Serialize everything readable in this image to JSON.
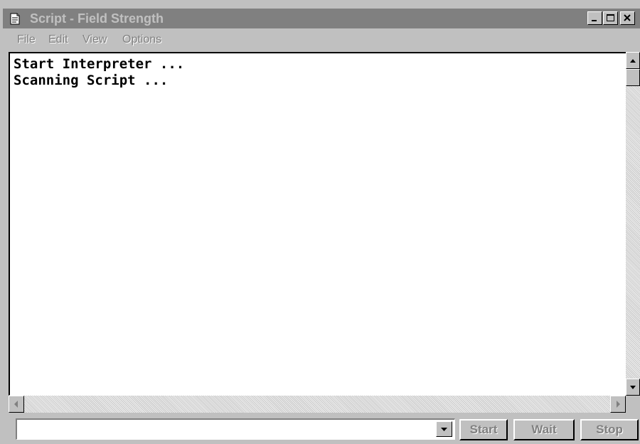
{
  "window": {
    "title": "Script - Field Strength"
  },
  "menu": {
    "items": [
      {
        "label": "File"
      },
      {
        "label": "Edit"
      },
      {
        "label": "View"
      },
      {
        "label": "Options"
      }
    ]
  },
  "output": {
    "lines": [
      "Start Interpreter ...",
      "Scanning Script ..."
    ]
  },
  "command": {
    "value": ""
  },
  "buttons": {
    "start": "Start",
    "wait": "Wait",
    "stop": "Stop"
  },
  "colors": {
    "title_bar_inactive": "#808080",
    "face": "#c0c0c0",
    "disabled_text": "#808080"
  }
}
